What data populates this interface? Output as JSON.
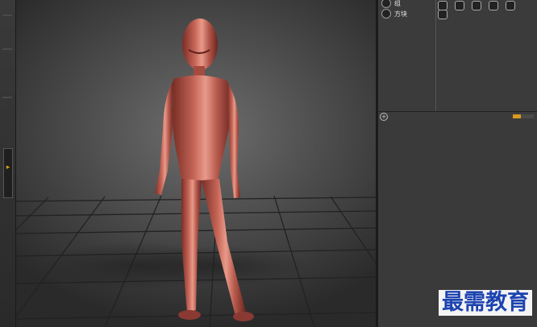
{
  "panel": {
    "rows": [
      {
        "label": "组"
      },
      {
        "label": "方块"
      }
    ],
    "toolbar_icons": [
      "dial-icon",
      "hex-icon",
      "refresh-icon",
      "clock-icon",
      "info-icon",
      "cube-icon"
    ],
    "progress": 0.4
  },
  "watermark": {
    "text": "最需教育"
  },
  "colors": {
    "accent": "#d99a1f",
    "watermark": "#1c43b0",
    "figure": "#b8574a"
  }
}
